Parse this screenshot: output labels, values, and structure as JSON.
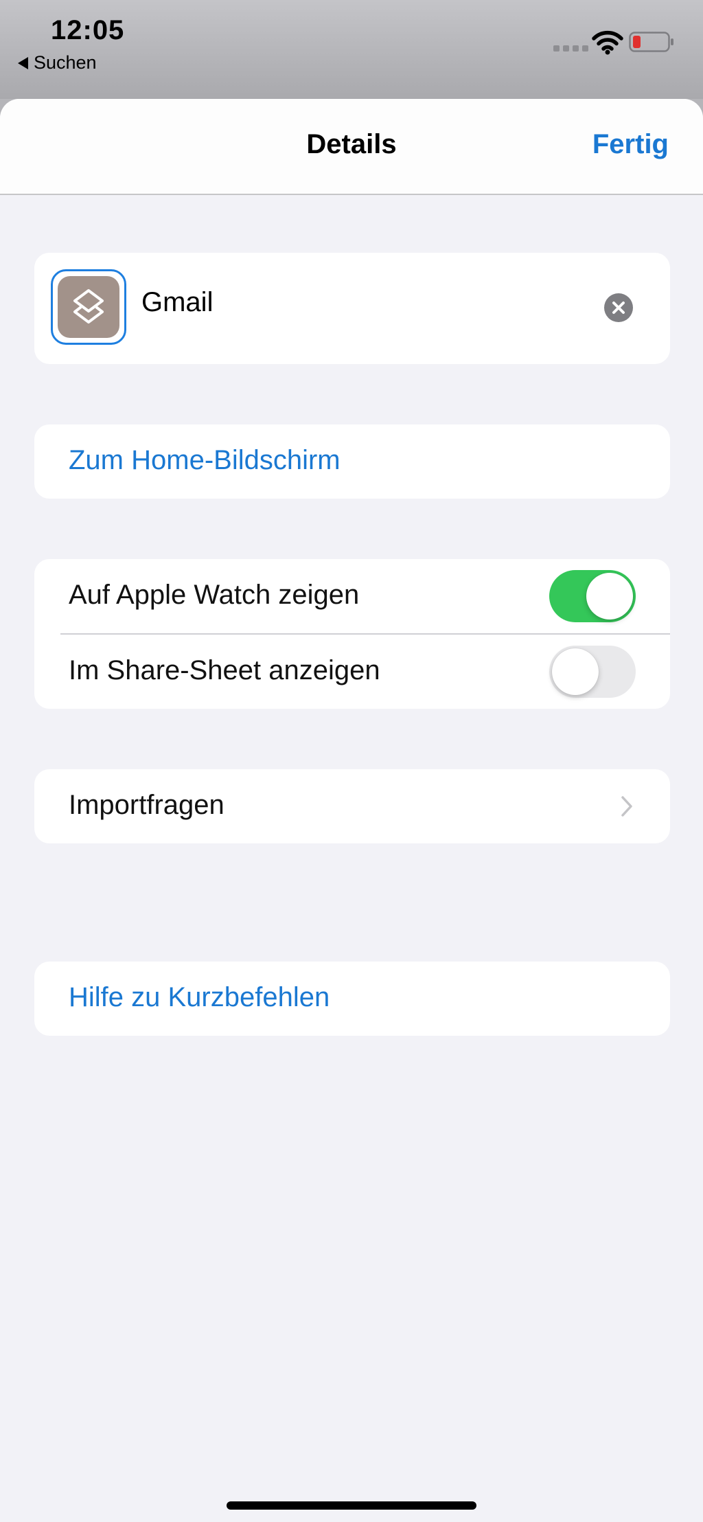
{
  "status_bar": {
    "time": "12:05",
    "back_label": "Suchen",
    "icons": [
      "cellular-signal-icon",
      "wifi-icon",
      "battery-low-icon"
    ],
    "battery_color": "#e0302e"
  },
  "nav": {
    "title": "Details",
    "done_label": "Fertig"
  },
  "shortcut": {
    "name": "Gmail",
    "icon": "shortcuts-layers-icon",
    "icon_background": "#a2928a"
  },
  "actions": {
    "add_home_label": "Zum Home-Bildschirm",
    "help_label": "Hilfe zu Kurzbefehlen"
  },
  "toggles": {
    "apple_watch": {
      "label": "Auf Apple Watch zeigen",
      "on": true
    },
    "share_sheet": {
      "label": "Im Share-Sheet anzeigen",
      "on": false
    }
  },
  "import_questions": {
    "label": "Importfragen"
  },
  "colors": {
    "accent": "#1a78d2",
    "toggle_on": "#34c759",
    "toggle_off": "#e9e9eb",
    "background": "#f2f2f7"
  }
}
